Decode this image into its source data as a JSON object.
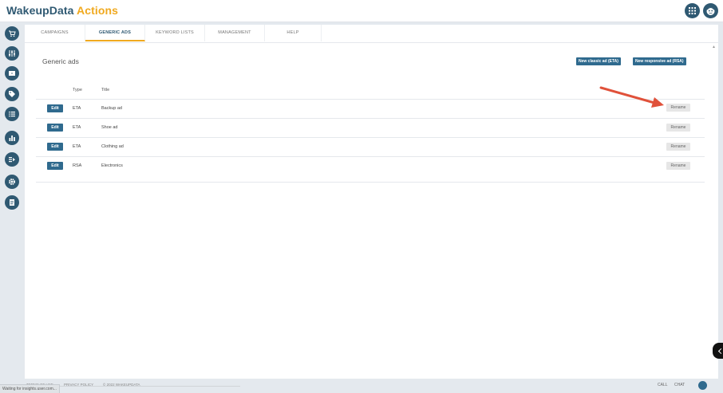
{
  "brand": {
    "part1": "WakeupData",
    "part2": "Actions"
  },
  "icons": {
    "top": [
      "grid-icon",
      "avatar-icon"
    ],
    "sidebar": [
      "cart-icon",
      "sliders-icon",
      "box-icon",
      "tag-icon",
      "list-icon",
      "bar-chart-icon",
      "export-icon",
      "gear-icon",
      "document-icon"
    ]
  },
  "tabs": [
    {
      "label": "CAMPAIGNS",
      "active": false
    },
    {
      "label": "GENERIC ADS",
      "active": true
    },
    {
      "label": "KEYWORD LISTS",
      "active": false
    },
    {
      "label": "MANAGEMENT",
      "active": false
    },
    {
      "label": "HELP",
      "active": false
    }
  ],
  "page": {
    "title": "Generic ads",
    "btn_new_eta": "New classic ad (ETA)",
    "btn_new_rsa": "New responsive ad (RSA)"
  },
  "table": {
    "headers": {
      "type": "Type",
      "title": "Title"
    },
    "rows": [
      {
        "edit": "Edit",
        "type": "ETA",
        "title": "Backup ad",
        "rename": "Rename"
      },
      {
        "edit": "Edit",
        "type": "ETA",
        "title": "Shoe ad",
        "rename": "Rename"
      },
      {
        "edit": "Edit",
        "type": "ETA",
        "title": "Clothing ad",
        "rename": "Rename"
      },
      {
        "edit": "Edit",
        "type": "RSA",
        "title": "Electronics",
        "rename": "Rename"
      }
    ]
  },
  "annotation": {
    "arrow_color": "#e0513a"
  },
  "colors": {
    "brand_blue": "#2f5972",
    "brand_orange": "#f0a91f",
    "button_blue": "#2f6a8e"
  },
  "footer": {
    "terms": "TERMS OF USE",
    "privacy": "PRIVACY POLICY",
    "copyright": "© 2022 WAKEUPDATA",
    "call": "CALL",
    "chat": "CHAT"
  },
  "status": {
    "text": "Waiting for insights.user.com..."
  }
}
